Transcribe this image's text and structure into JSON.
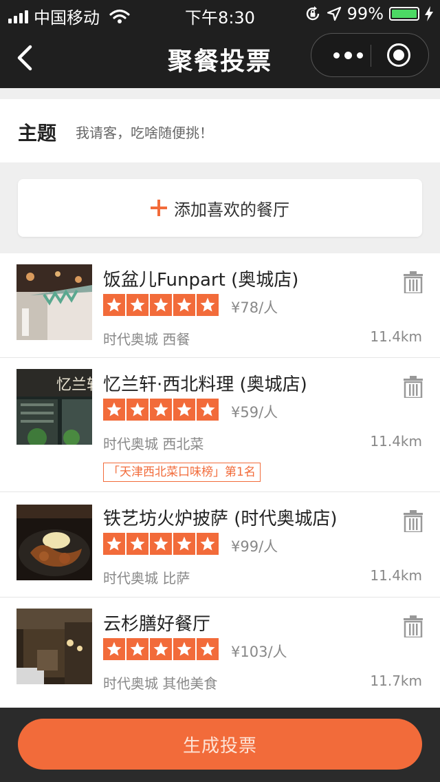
{
  "status_bar": {
    "carrier": "中国移动",
    "time": "下午8:30",
    "battery_percent": "99%",
    "battery_level": 0.99,
    "icons": [
      "signal-icon",
      "wifi-icon",
      "orientation-lock-icon",
      "location-arrow-icon",
      "battery-icon",
      "charging-bolt-icon"
    ]
  },
  "nav": {
    "title": "聚餐投票",
    "icons": [
      "back-chevron-icon",
      "more-dots-icon",
      "record-target-icon"
    ]
  },
  "theme": {
    "label": "主题",
    "value": "我请客，吃啥随便挑！"
  },
  "add_button": {
    "label": "添加喜欢的餐厅"
  },
  "restaurants": [
    {
      "name": "饭盆儿Funpart (奥城店)",
      "rating": 5,
      "price": "¥78/人",
      "area": "时代奥城   西餐",
      "distance": "11.4km",
      "rank_badge": ""
    },
    {
      "name": "忆兰轩·西北料理 (奥城店)",
      "rating": 5,
      "price": "¥59/人",
      "area": "时代奥城   西北菜",
      "distance": "11.4km",
      "rank_badge": "「天津西北菜口味榜」第1名"
    },
    {
      "name": "铁艺坊火炉披萨 (时代奥城店)",
      "rating": 5,
      "price": "¥99/人",
      "area": "时代奥城   比萨",
      "distance": "11.4km",
      "rank_badge": ""
    },
    {
      "name": "云杉膳好餐厅",
      "rating": 5,
      "price": "¥103/人",
      "area": "时代奥城   其他美食",
      "distance": "11.7km",
      "rank_badge": ""
    }
  ],
  "bottom": {
    "generate_label": "生成投票"
  },
  "colors": {
    "accent": "#f26b3a",
    "header_bg": "#1f1f1f",
    "battery_green": "#4cd964"
  }
}
